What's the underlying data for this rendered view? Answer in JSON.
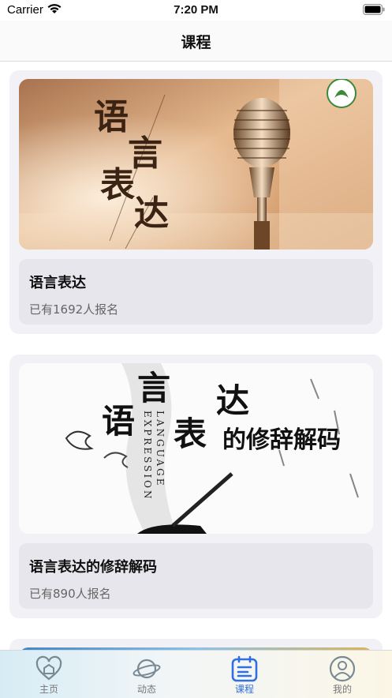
{
  "status_bar": {
    "carrier": "Carrier",
    "time": "7:20 PM"
  },
  "nav": {
    "title": "课程"
  },
  "courses": [
    {
      "name": "语言表达",
      "enrolled": "已有1692人报名",
      "banner_text": [
        "语",
        "言",
        "表",
        "达"
      ]
    },
    {
      "name": "语言表达的修辞解码",
      "enrolled": "已有890人报名",
      "banner_text": [
        "言",
        "达",
        "语",
        "表",
        "的修辞解码",
        "LANGUAGE",
        "EXPRESSION"
      ]
    }
  ],
  "tabs": [
    {
      "label": "主页",
      "icon": "heart-home-icon",
      "active": false
    },
    {
      "label": "动态",
      "icon": "planet-icon",
      "active": false
    },
    {
      "label": "课程",
      "icon": "calendar-list-icon",
      "active": true
    },
    {
      "label": "我的",
      "icon": "user-icon",
      "active": false
    }
  ],
  "colors": {
    "accent": "#2f6fe0",
    "card_bg": "#f2f2f6",
    "info_bg": "#e6e6ec"
  }
}
